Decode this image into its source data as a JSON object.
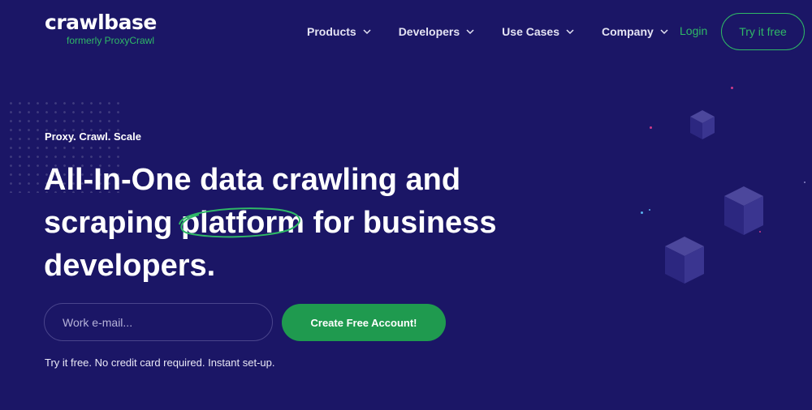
{
  "header": {
    "logo": "crawlbase",
    "logo_sub": "formerly ProxyCrawl",
    "nav": [
      {
        "label": "Products"
      },
      {
        "label": "Developers"
      },
      {
        "label": "Use Cases"
      },
      {
        "label": "Company"
      }
    ],
    "login": "Login",
    "cta": "Try it free"
  },
  "hero": {
    "eyebrow": "Proxy. Crawl. Scale",
    "headline_part1": "All-In-One data crawling and scraping ",
    "headline_highlight": "platform",
    "headline_part2": " for business developers.",
    "email_placeholder": "Work e-mail...",
    "cta": "Create Free Account!",
    "note": "Try it free. No credit card required. Instant set-up."
  },
  "colors": {
    "background": "#1b1666",
    "accent_green": "#2fb866",
    "button_green": "#1f9a4f"
  },
  "icons": [
    "chevron-down-icon",
    "cube-icon"
  ]
}
